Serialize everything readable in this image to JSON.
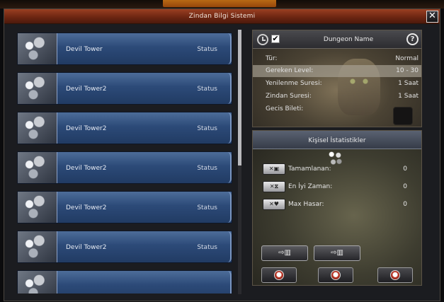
{
  "window": {
    "title": "Zindan Bilgi Sistemi",
    "close_label": "✕"
  },
  "dungeon_list": [
    {
      "name": "Devil Tower",
      "status": "Status"
    },
    {
      "name": "Devil Tower2",
      "status": "Status"
    },
    {
      "name": "Devil Tower2",
      "status": "Status"
    },
    {
      "name": "Devil Tower2",
      "status": "Status"
    },
    {
      "name": "Devil Tower2",
      "status": "Status"
    },
    {
      "name": "Devil Tower2",
      "status": "Status"
    },
    {
      "name": "",
      "status": ""
    }
  ],
  "scroll": {
    "position": 0.0
  },
  "info": {
    "title": "Dungeon Name",
    "checkbox_mark": "✔",
    "help_glyph": "?",
    "rows": [
      {
        "label": "Tür:",
        "value": "Normal"
      },
      {
        "label": "Gereken Level:",
        "value": "10 - 30"
      },
      {
        "label": "Yenilenme Suresi:",
        "value": "1 Saat"
      },
      {
        "label": "Zindan Suresi:",
        "value": "1 Saat"
      },
      {
        "label": "Gecis Bileti:",
        "value": ""
      }
    ]
  },
  "stats": {
    "title": "Kişisel İstatistikler",
    "rows": [
      {
        "icon_text": "✕▣",
        "label": "Tamamlanan:",
        "value": "0"
      },
      {
        "icon_text": "✕⧖",
        "label": "En İyi Zaman:",
        "value": "0"
      },
      {
        "icon_text": "✕♥",
        "label": "Max Hasar:",
        "value": "0"
      }
    ],
    "action_buttons": [
      "⇨▥",
      "⇨▥"
    ]
  },
  "colors": {
    "title_bar": "#7a2c16",
    "list_item": "#2c4a78",
    "accent_red": "#c23b2a"
  }
}
